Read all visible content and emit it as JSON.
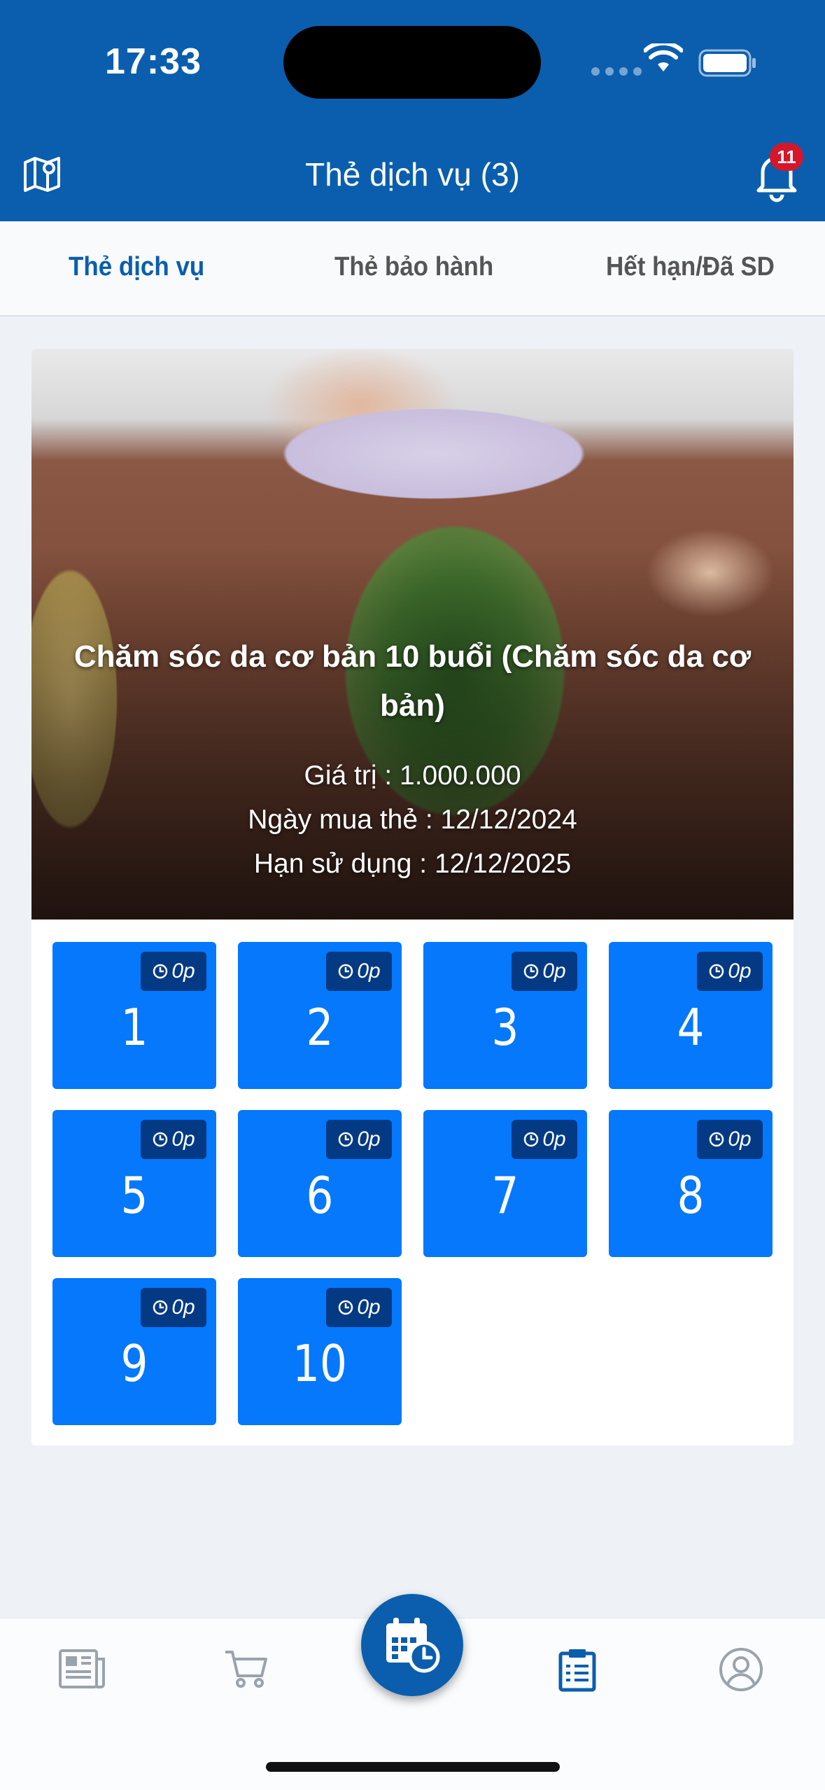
{
  "status_bar": {
    "time": "17:33"
  },
  "header": {
    "title": "Thẻ dịch vụ (3)",
    "notification_count": "11"
  },
  "tabs": [
    {
      "label": "Thẻ dịch vụ",
      "active": true
    },
    {
      "label": "Thẻ bảo hành",
      "active": false
    },
    {
      "label": "Hết hạn/Đã SD",
      "active": false
    }
  ],
  "card": {
    "title": "Chăm sóc da cơ bản 10 buổi (Chăm sóc da cơ bản)",
    "value_line": "Giá trị : 1.000.000",
    "purchase_line": "Ngày mua thẻ : 12/12/2024",
    "expiry_line": "Hạn sử dụng : 12/12/2025",
    "sessions": [
      {
        "number": "1",
        "duration": "0p"
      },
      {
        "number": "2",
        "duration": "0p"
      },
      {
        "number": "3",
        "duration": "0p"
      },
      {
        "number": "4",
        "duration": "0p"
      },
      {
        "number": "5",
        "duration": "0p"
      },
      {
        "number": "6",
        "duration": "0p"
      },
      {
        "number": "7",
        "duration": "0p"
      },
      {
        "number": "8",
        "duration": "0p"
      },
      {
        "number": "9",
        "duration": "0p"
      },
      {
        "number": "10",
        "duration": "0p"
      }
    ]
  },
  "bottom_nav": {
    "items": [
      {
        "icon": "news-icon",
        "active": false
      },
      {
        "icon": "cart-icon",
        "active": false
      },
      {
        "icon": "calendar-clock-icon",
        "active": false,
        "center": true
      },
      {
        "icon": "clipboard-icon",
        "active": true
      },
      {
        "icon": "user-icon",
        "active": false
      }
    ]
  },
  "colors": {
    "primary": "#0a5ead",
    "tile": "#0578fb",
    "tile_badge": "#043a84",
    "badge_red": "#d6162a"
  }
}
